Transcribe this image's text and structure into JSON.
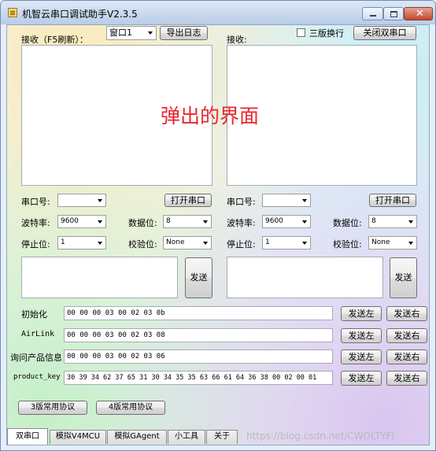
{
  "window": {
    "title": "机智云串口调试助手V2.3.5",
    "buttons": {
      "minimize": "minimize",
      "maximize": "maximize",
      "close": "✕"
    }
  },
  "left_panel": {
    "receive_label": "接收（F5刷新）：",
    "port_select_value": "窗口1",
    "export_log_button": "导出日志",
    "port_label": "串口号:",
    "port_value": "",
    "open_port_button": "打开串口",
    "baud_label": "波特率:",
    "baud_value": "9600",
    "databits_label": "数据位:",
    "databits_value": "8",
    "stopbits_label": "停止位:",
    "stopbits_value": "1",
    "parity_label": "校验位:",
    "parity_value": "None",
    "send_button": "发送"
  },
  "right_panel": {
    "receive_label": "接收:",
    "wrap_checkbox_label": "三版换行",
    "close_dual_button": "关闭双串口",
    "port_label": "串口号:",
    "port_value": "",
    "open_port_button": "打开串口",
    "baud_label": "波特率:",
    "baud_value": "9600",
    "databits_label": "数据位:",
    "databits_value": "8",
    "stopbits_label": "停止位:",
    "stopbits_value": "1",
    "parity_label": "校验位:",
    "parity_value": "None",
    "send_button": "发送"
  },
  "popup_annotation": "弹出的界面",
  "commands": [
    {
      "label": "初始化",
      "value": "00 00 00 03 00 02 03 0b",
      "send_left": "发送左",
      "send_right": "发送右"
    },
    {
      "label": "AirLink",
      "value": "00 00 00 03 00 02 03 08",
      "send_left": "发送左",
      "send_right": "发送右"
    },
    {
      "label": "询问产品信息",
      "value": "00 00 00 03 00 02 03 06",
      "send_left": "发送左",
      "send_right": "发送右"
    },
    {
      "label": "product_key",
      "value": "30 39 34 62 37 65 31 30 34 35 35 63 66 61 64 36 38 00 02 00 01",
      "send_left": "发送左",
      "send_right": "发送右"
    }
  ],
  "protocol_buttons": {
    "v3": "3版常用协议",
    "v4": "4版常用协议"
  },
  "tabs": [
    {
      "label": "双串口",
      "active": true
    },
    {
      "label": "模拟V4MCU",
      "active": false
    },
    {
      "label": "模拟GAgent",
      "active": false
    },
    {
      "label": "小工具",
      "active": false
    },
    {
      "label": "关于",
      "active": false
    }
  ],
  "watermark": "https://blog.csdn.net/CWOLTYFI"
}
